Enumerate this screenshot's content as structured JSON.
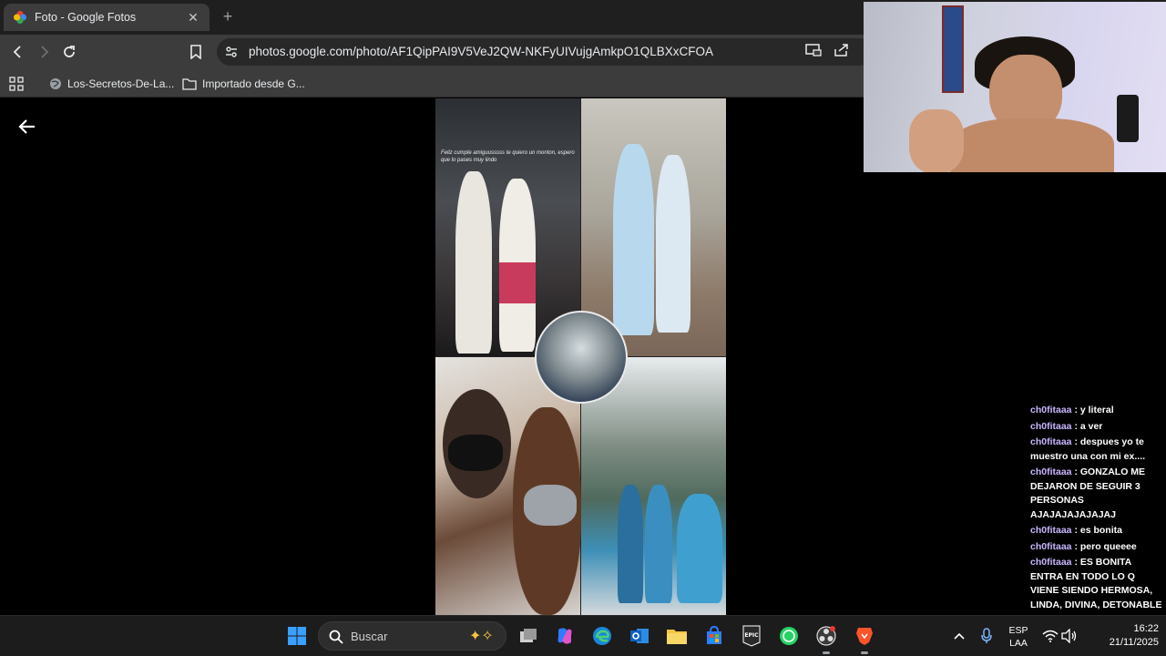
{
  "browser": {
    "tab_title": "Foto - Google Fotos",
    "url": "photos.google.com/photo/AF1QipPAI9V5VeJ2QW-NKFyUIVujgAmkpO1QLBXxCFOA",
    "bookmarks": [
      {
        "label": "Los-Secretos-De-La..."
      },
      {
        "label": "Importado desde G..."
      }
    ]
  },
  "photo": {
    "caption": "Feliz cumple amiguusssss te quiero un monton, espero que lo pases muy lindo"
  },
  "chat": {
    "messages": [
      {
        "user": "ch0fitaaa",
        "text": "y literal"
      },
      {
        "user": "ch0fitaaa",
        "text": "a ver"
      },
      {
        "user": "ch0fitaaa",
        "text": "despues yo te muestro una con mi ex...."
      },
      {
        "user": "ch0fitaaa",
        "text": "GONZALO ME DEJARON DE SEGUIR 3 PERSONAS AJAJAJAJAJAJAJ"
      },
      {
        "user": "ch0fitaaa",
        "text": "es bonita"
      },
      {
        "user": "ch0fitaaa",
        "text": "pero queeee"
      },
      {
        "user": "ch0fitaaa",
        "text": "ES BONITA ENTRA EN TODO LO Q VIENE SIENDO HERMOSA, LINDA, DIVINA, DETONABLE"
      }
    ]
  },
  "taskbar": {
    "search_label": "Buscar",
    "lang_line1": "ESP",
    "lang_line2": "LAA",
    "time": "16:22",
    "date": "21/11/2025"
  },
  "colors": {
    "chat_user": "#c9b6ff",
    "toolbar_bg": "#3c3c3c",
    "tabstrip_bg": "#1f1f1f"
  }
}
